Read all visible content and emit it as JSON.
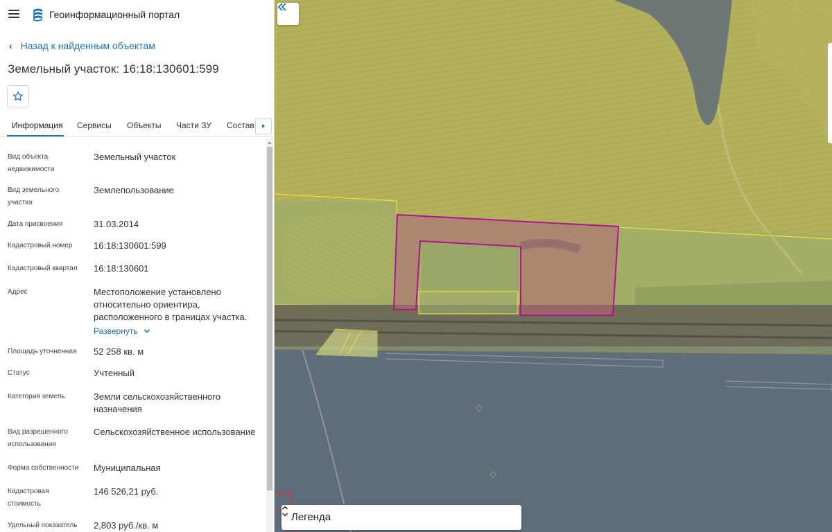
{
  "header": {
    "app_title": "Геоинформационный портал",
    "menu_icon": "hamburger-menu-icon",
    "logo_icon": "portal-logo-icon"
  },
  "nav": {
    "back_label": "Назад к найденным объектам"
  },
  "object": {
    "title": "Земельный участок: 16:18:130601:599"
  },
  "tabs": [
    {
      "label": "Информация",
      "active": true
    },
    {
      "label": "Сервисы",
      "active": false
    },
    {
      "label": "Объекты",
      "active": false
    },
    {
      "label": "Части ЗУ",
      "active": false
    },
    {
      "label": "Состав",
      "active": false
    }
  ],
  "info": {
    "rows": [
      {
        "label": "Вид объекта недвижимости",
        "value": "Земельный участок"
      },
      {
        "label": "Вид земельного участка",
        "value": "Землепользование"
      },
      {
        "label": "Дата присвоения",
        "value": "31.03.2014"
      },
      {
        "label": "Кадастровый номер",
        "value": "16:18:130601:599"
      },
      {
        "label": "Кадастровый квартал",
        "value": "16:18:130601"
      },
      {
        "label": "Адрес",
        "value": "Местоположение установлено относительно ориентира, расположенного в границах участка."
      },
      {
        "label": "Площадь уточненная",
        "value": "52 258 кв. м"
      },
      {
        "label": "Статус",
        "value": "Учтенный"
      },
      {
        "label": "Категория земель",
        "value": "Земли сельскохозяйственного назначения"
      },
      {
        "label": "Вид разрешенного использования",
        "value": "Сельскохозяйственное использование"
      },
      {
        "label": "Форма собственности",
        "value": "Муниципальная"
      },
      {
        "label": "Кадастровая стоимость",
        "value": "146 526,21 руб."
      },
      {
        "label": "Удельный показатель",
        "value": "2,803 руб./кв. м"
      }
    ],
    "expand_label": "Развернуть"
  },
  "map": {
    "legend_label": "Легенда",
    "colors": {
      "field_yellow": "#b7b35c",
      "gray_zone": "#5f6d7a",
      "parcel_outline": "#b0148c",
      "parcel_fill": "#b5687c",
      "boundary_yellow": "#e6e23a",
      "road": "#6c6a58"
    }
  },
  "colors": {
    "accent": "#1a73b8"
  }
}
